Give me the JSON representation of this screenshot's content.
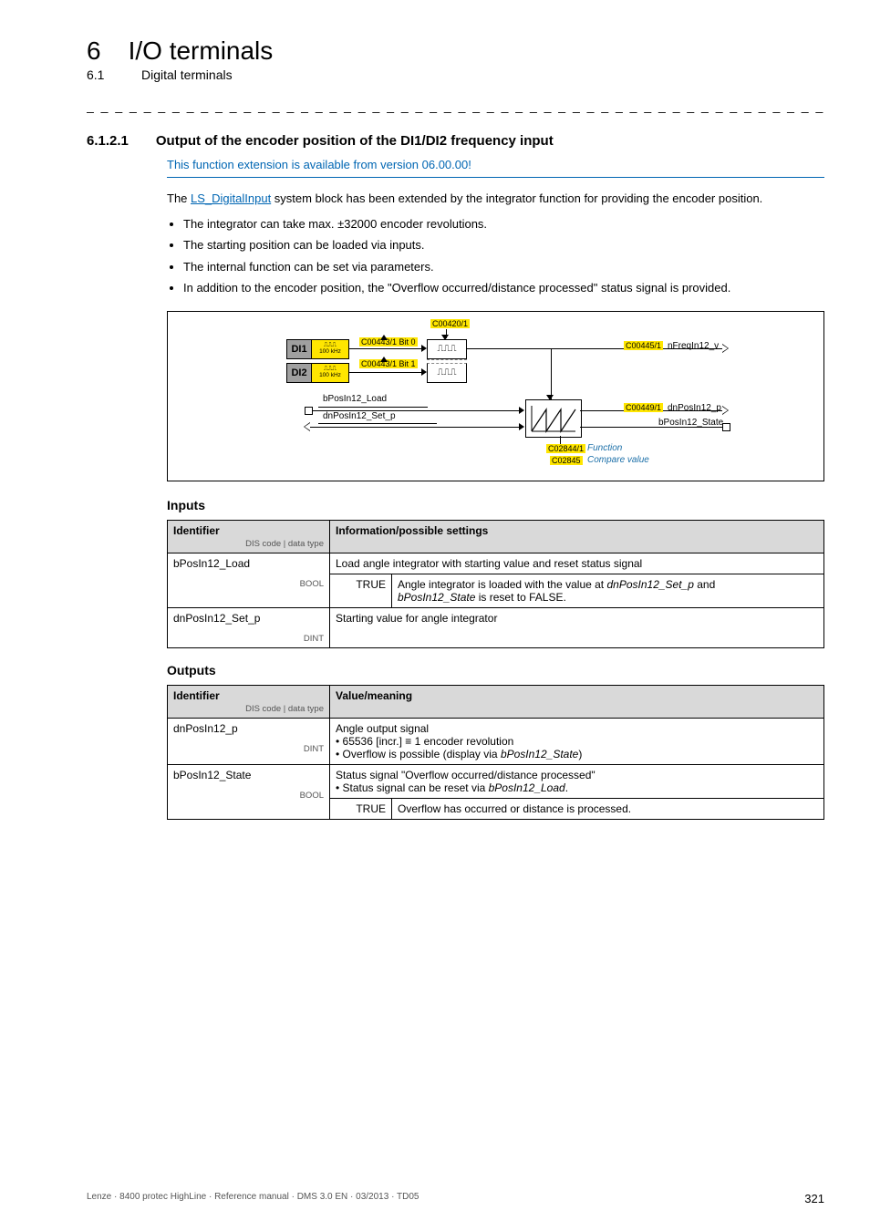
{
  "chapter": {
    "num": "6",
    "title": "I/O terminals"
  },
  "section": {
    "num": "6.1",
    "title": "Digital terminals"
  },
  "dashes": "_ _ _ _ _ _ _ _ _ _ _ _ _ _ _ _ _ _ _ _ _ _ _ _ _ _ _ _ _ _ _ _ _ _ _ _ _ _ _ _ _ _ _ _ _ _ _ _ _ _ _ _ _ _ _ _ _ _ _ _ _ _ _ _",
  "subsection": {
    "num": "6.1.2.1",
    "title": "Output of the encoder position of the DI1/DI2 frequency input",
    "version_note": "This function extension is available from version 06.00.00!",
    "intro_pre": "The ",
    "intro_link": "LS_DigitalInput",
    "intro_post": " system block has been extended by the integrator function for providing the encoder position.",
    "bullets": [
      "The integrator can take max. ±32000 encoder revolutions.",
      "The starting position can be loaded via inputs.",
      "The internal function can be set via parameters.",
      "In addition to the encoder position, the \"Overflow occurred/distance processed\" status signal is provided."
    ]
  },
  "diagram": {
    "di1": "DI1",
    "di2": "DI2",
    "hz": "100 kHz",
    "c00420": "C00420/1",
    "c00443b0": "C00443/1 Bit 0",
    "c00443b1": "C00443/1 Bit 1",
    "c00445": "C00445/1",
    "c00449": "C00449/1",
    "c02844": "C02844/1",
    "c02845": "C02845",
    "funcLabel": "Function",
    "compLabel": "Compare value",
    "nFreq": "nFreqIn12_v",
    "dnPos": "dnPosIn12_p",
    "bState": "bPosIn12_State",
    "bLoad": "bPosIn12_Load",
    "dnSet": "dnPosIn12_Set_p",
    "wave_top": "⎍⎍⎍",
    "pulse1": "⎍⎍⎍",
    "pulse2": "⎍⎍⎍"
  },
  "inputs": {
    "title": "Inputs",
    "head1": "Identifier",
    "head1_sub": "DIS code | data type",
    "head2": "Information/possible settings",
    "rows": [
      {
        "id": "bPosIn12_Load",
        "dtype": "BOOL",
        "info_top": "Load angle integrator with starting value and reset status signal",
        "sub_val": "TRUE",
        "sub_desc_pre": "Angle integrator is loaded with the value at ",
        "sub_desc_ital1": "dnPosIn12_Set_p",
        "sub_desc_mid": " and ",
        "sub_desc_ital2": "bPosIn12_State",
        "sub_desc_post": " is reset to FALSE."
      },
      {
        "id": "dnPosIn12_Set_p",
        "dtype": "DINT",
        "info_top": "Starting value for angle integrator"
      }
    ]
  },
  "outputs": {
    "title": "Outputs",
    "head1": "Identifier",
    "head1_sub": "DIS code | data type",
    "head2": "Value/meaning",
    "rows": [
      {
        "id": "dnPosIn12_p",
        "dtype": "DINT",
        "lines": [
          "Angle output signal",
          "• 65536 [incr.] ≡ 1 encoder revolution",
          "• Overflow is possible (display via "
        ],
        "line3_ital": "bPosIn12_State",
        "line3_post": ")"
      },
      {
        "id": "bPosIn12_State",
        "dtype": "BOOL",
        "lines": [
          "Status signal \"Overflow occurred/distance processed\"",
          "• Status signal can be reset via "
        ],
        "line2_ital": "bPosIn12_Load",
        "line2_post": ".",
        "sub_val": "TRUE",
        "sub_desc": "Overflow has occurred or distance is processed."
      }
    ]
  },
  "footer": {
    "left": "Lenze · 8400 protec HighLine · Reference manual · DMS 3.0 EN · 03/2013 · TD05",
    "page": "321"
  }
}
